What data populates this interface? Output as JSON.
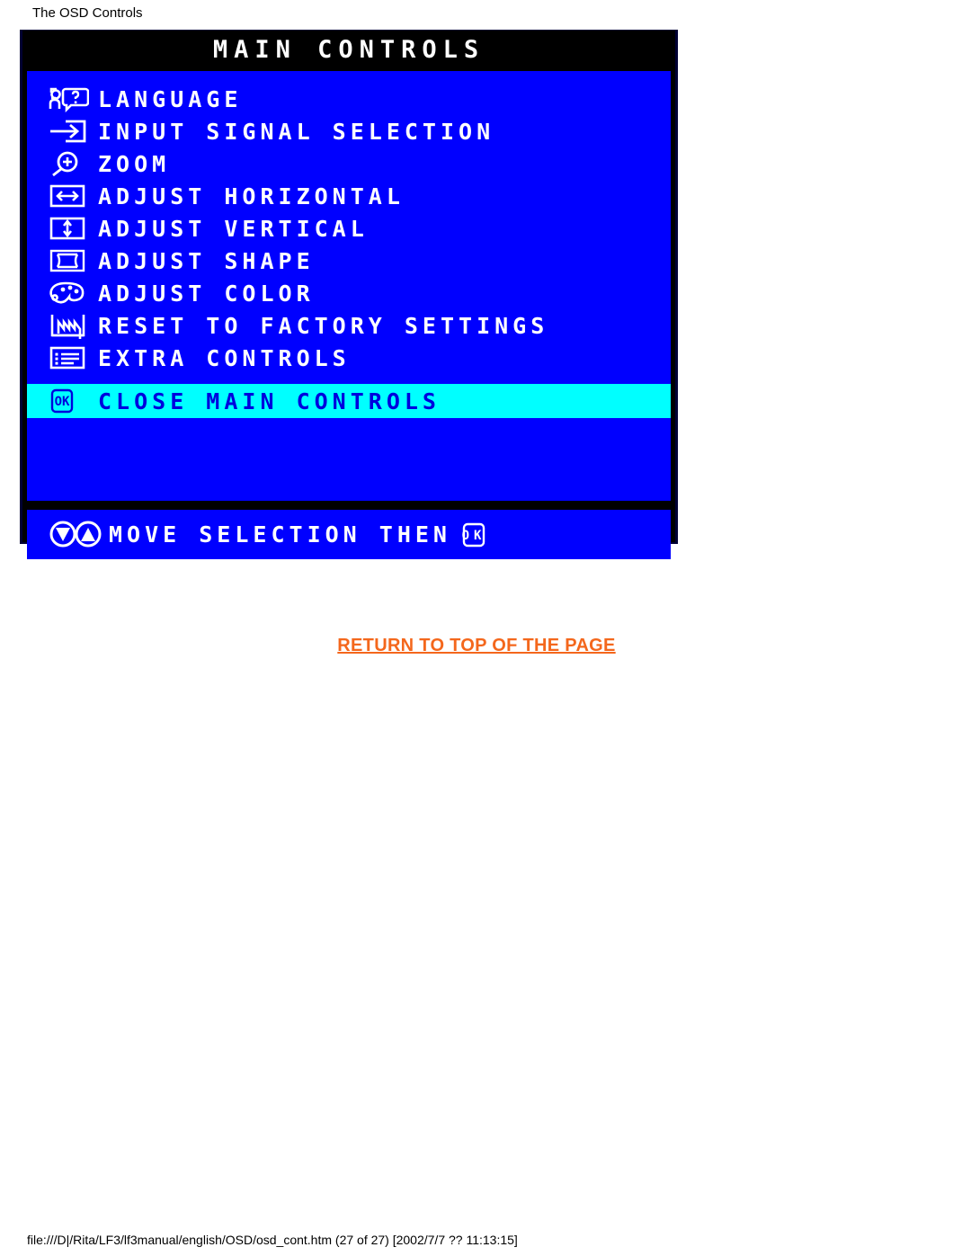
{
  "page": {
    "heading": "The OSD Controls",
    "file_path": "file:///D|/Rita/LF3/lf3manual/english/OSD/osd_cont.htm (27 of 27) [2002/7/7 ?? 11:13:15]",
    "return_link": "RETURN TO TOP OF THE PAGE"
  },
  "colors": {
    "osd_background": "#0000FF",
    "osd_titlebar": "#000000",
    "osd_border": "#000033",
    "osd_text": "#FFFFFF",
    "highlight_background": "#00FFFF",
    "highlight_text": "#0000DD",
    "link": "#F4671C"
  },
  "osd": {
    "title": "MAIN CONTROLS",
    "items": [
      {
        "icon": "person-question-icon",
        "label": "LANGUAGE"
      },
      {
        "icon": "arrow-into-box-icon",
        "label": "INPUT SIGNAL SELECTION"
      },
      {
        "icon": "magnifier-plus-icon",
        "label": "ZOOM"
      },
      {
        "icon": "horizontal-arrows-box-icon",
        "label": "ADJUST HORIZONTAL"
      },
      {
        "icon": "vertical-arrows-box-icon",
        "label": "ADJUST VERTICAL"
      },
      {
        "icon": "pincushion-shape-icon",
        "label": "ADJUST SHAPE"
      },
      {
        "icon": "color-palette-icon",
        "label": "ADJUST COLOR"
      },
      {
        "icon": "factory-icon",
        "label": "RESET TO FACTORY SETTINGS"
      },
      {
        "icon": "list-lines-icon",
        "label": "EXTRA CONTROLS"
      }
    ],
    "highlighted_item": {
      "icon": "ok-button-icon",
      "label": "CLOSE MAIN CONTROLS"
    },
    "footer": {
      "icons": [
        "down-arrow-circle-icon",
        "up-arrow-circle-icon"
      ],
      "label": "MOVE SELECTION THEN",
      "trailing_icon": "ok-button-icon"
    }
  }
}
